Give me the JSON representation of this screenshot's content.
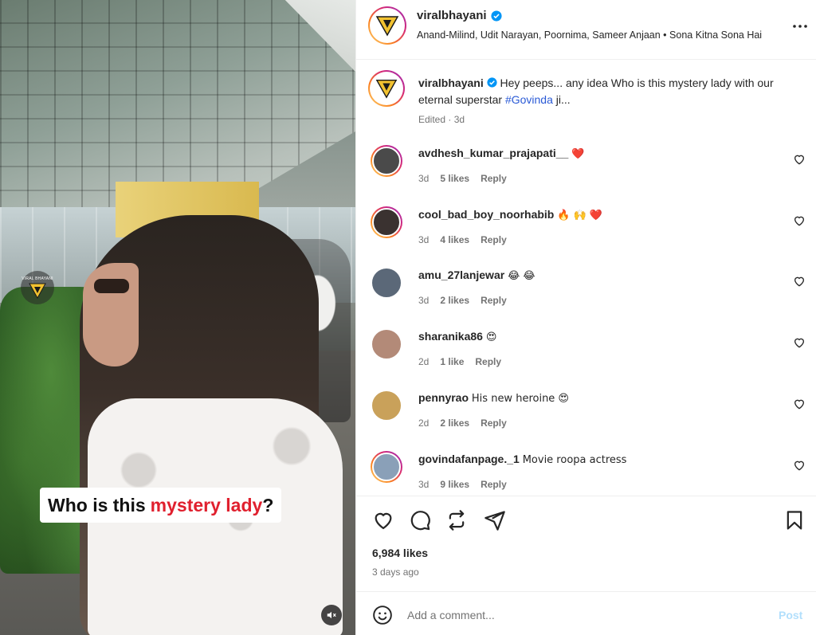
{
  "video": {
    "overlay_caption": {
      "before": "Who is this",
      "highlight": "mystery lady",
      "after": "?"
    },
    "watermark_text": "VIRAL BHAYANI",
    "mute_icon": "speaker-muted-icon"
  },
  "post": {
    "author": {
      "username": "viralbhayani",
      "verified": true,
      "audio": "Anand-Milind, Udit Narayan, Poornima, Sameer Anjaan • Sona Kitna Sona Hai"
    },
    "caption": {
      "username": "viralbhayani",
      "text_before": "Hey peeps... any idea Who is this mystery lady with our eternal superstar",
      "hashtag": "#Govinda",
      "text_after": "ji...",
      "meta": "Edited · 3d"
    },
    "comments": [
      {
        "username": "avdhesh_kumar_prajapati__",
        "text": "❤️",
        "time": "3d",
        "likes": "5 likes",
        "reply": "Reply",
        "avatar_color": "#4a4a4a",
        "ring": true
      },
      {
        "username": "cool_bad_boy_noorhabib",
        "text": "🔥 🙌 ❤️",
        "time": "3d",
        "likes": "4 likes",
        "reply": "Reply",
        "avatar_color": "#3a3230",
        "ring": true
      },
      {
        "username": "amu_27lanjewar",
        "text": "😂 😂",
        "time": "3d",
        "likes": "2 likes",
        "reply": "Reply",
        "avatar_color": "#5b6878",
        "ring": false
      },
      {
        "username": "sharanika86",
        "text": "😍",
        "time": "2d",
        "likes": "1 like",
        "reply": "Reply",
        "avatar_color": "#b38a78",
        "ring": false
      },
      {
        "username": "pennyrao",
        "text": "His new heroine 😍",
        "time": "2d",
        "likes": "2 likes",
        "reply": "Reply",
        "avatar_color": "#c9a15a",
        "ring": false
      },
      {
        "username": "govindafanpage._1",
        "text": "Movie roopa actress",
        "time": "3d",
        "likes": "9 likes",
        "reply": "Reply",
        "avatar_color": "#8aa0b8",
        "ring": true
      }
    ],
    "likes": "6,984 likes",
    "posted": "3 days ago",
    "add_comment": {
      "placeholder": "Add a comment...",
      "post_label": "Post"
    }
  },
  "colors": {
    "accent_blue": "#0095f6",
    "hashtag": "#2a5ad6",
    "caption_highlight": "#e0202e",
    "muted_text": "#737373"
  },
  "icons": [
    "more-icon",
    "verified-icon",
    "heart-icon",
    "comment-icon",
    "repost-icon",
    "share-icon",
    "bookmark-icon",
    "emoji-icon",
    "speaker-muted-icon"
  ]
}
